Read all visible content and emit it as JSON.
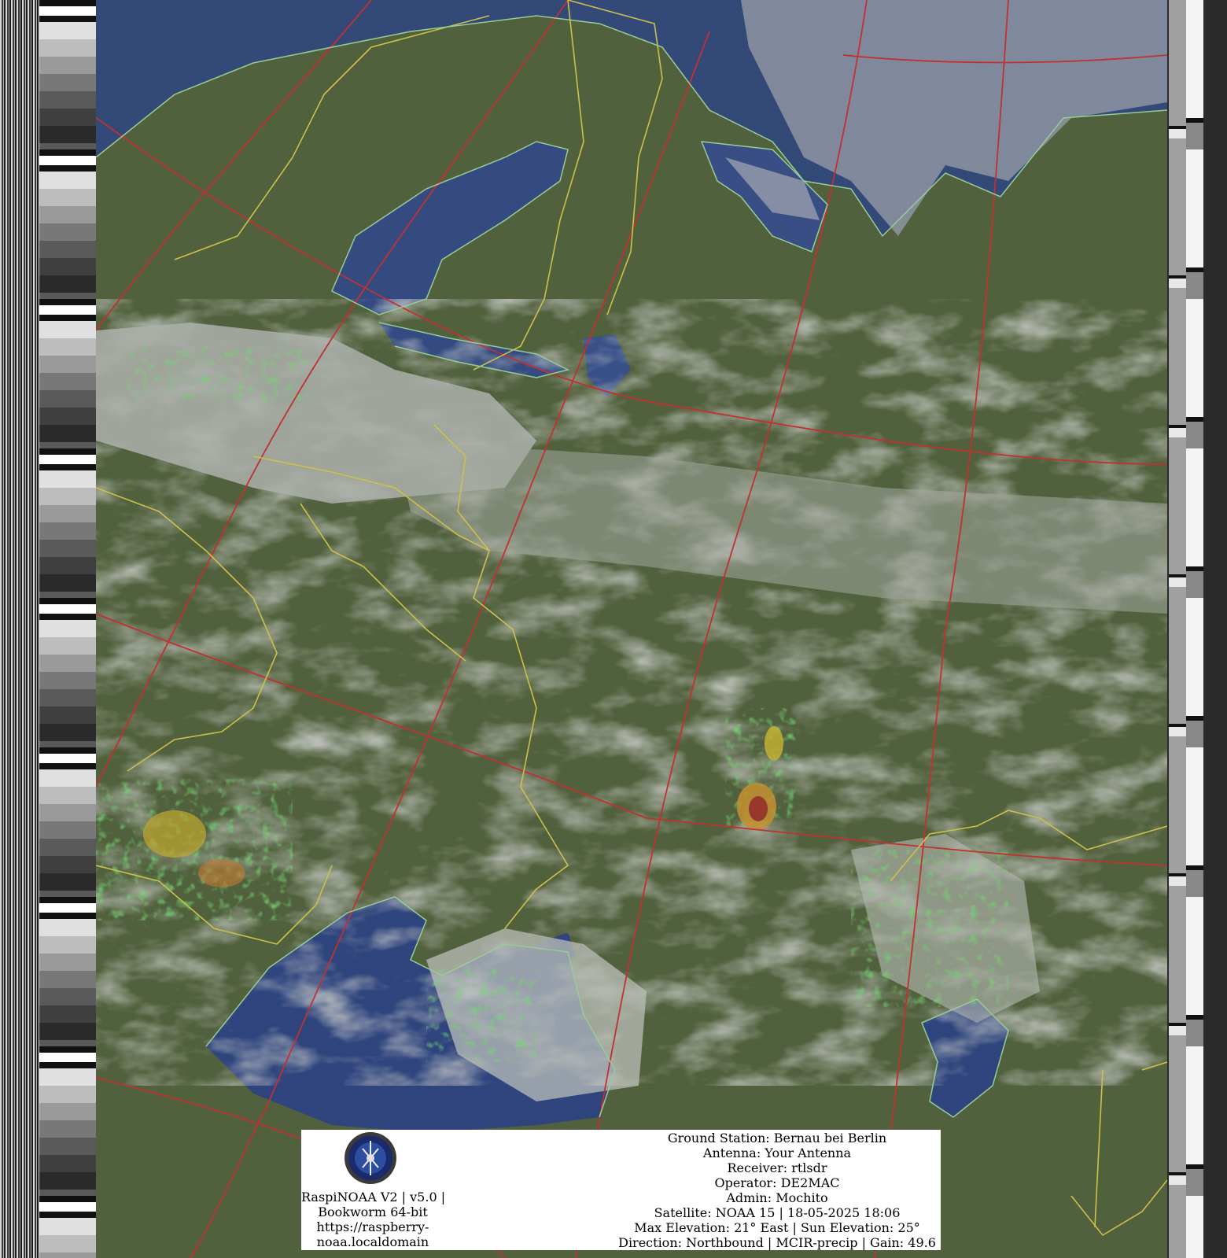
{
  "info_panel": {
    "left": {
      "line1": "RaspiNOAA V2 | v5.0 |",
      "line2": "Bookworm 64-bit",
      "line3": "https://raspberry-",
      "line4": "noaa.localdomain"
    },
    "right": {
      "ground_station": "Ground Station: Bernau bei Berlin",
      "antenna": "Antenna: Your Antenna",
      "receiver": "Receiver: rtlsdr",
      "operator": "Operator: DE2MAC",
      "admin": "Admin: Mochito",
      "satellite": "Satellite: NOAA 15 | 18-05-2025 18:06",
      "elevation": "Max Elevation: 21° East | Sun Elevation: 25°",
      "direction": "Direction: Northbound | MCIR-precip | Gain: 49.6"
    }
  },
  "colors": {
    "land": "#4b6030",
    "cloud": "#c8cec4",
    "sea": "#1f3a7a",
    "grid": "#e02020",
    "borders": "#f0e040",
    "coast": "#a8f0a8"
  }
}
